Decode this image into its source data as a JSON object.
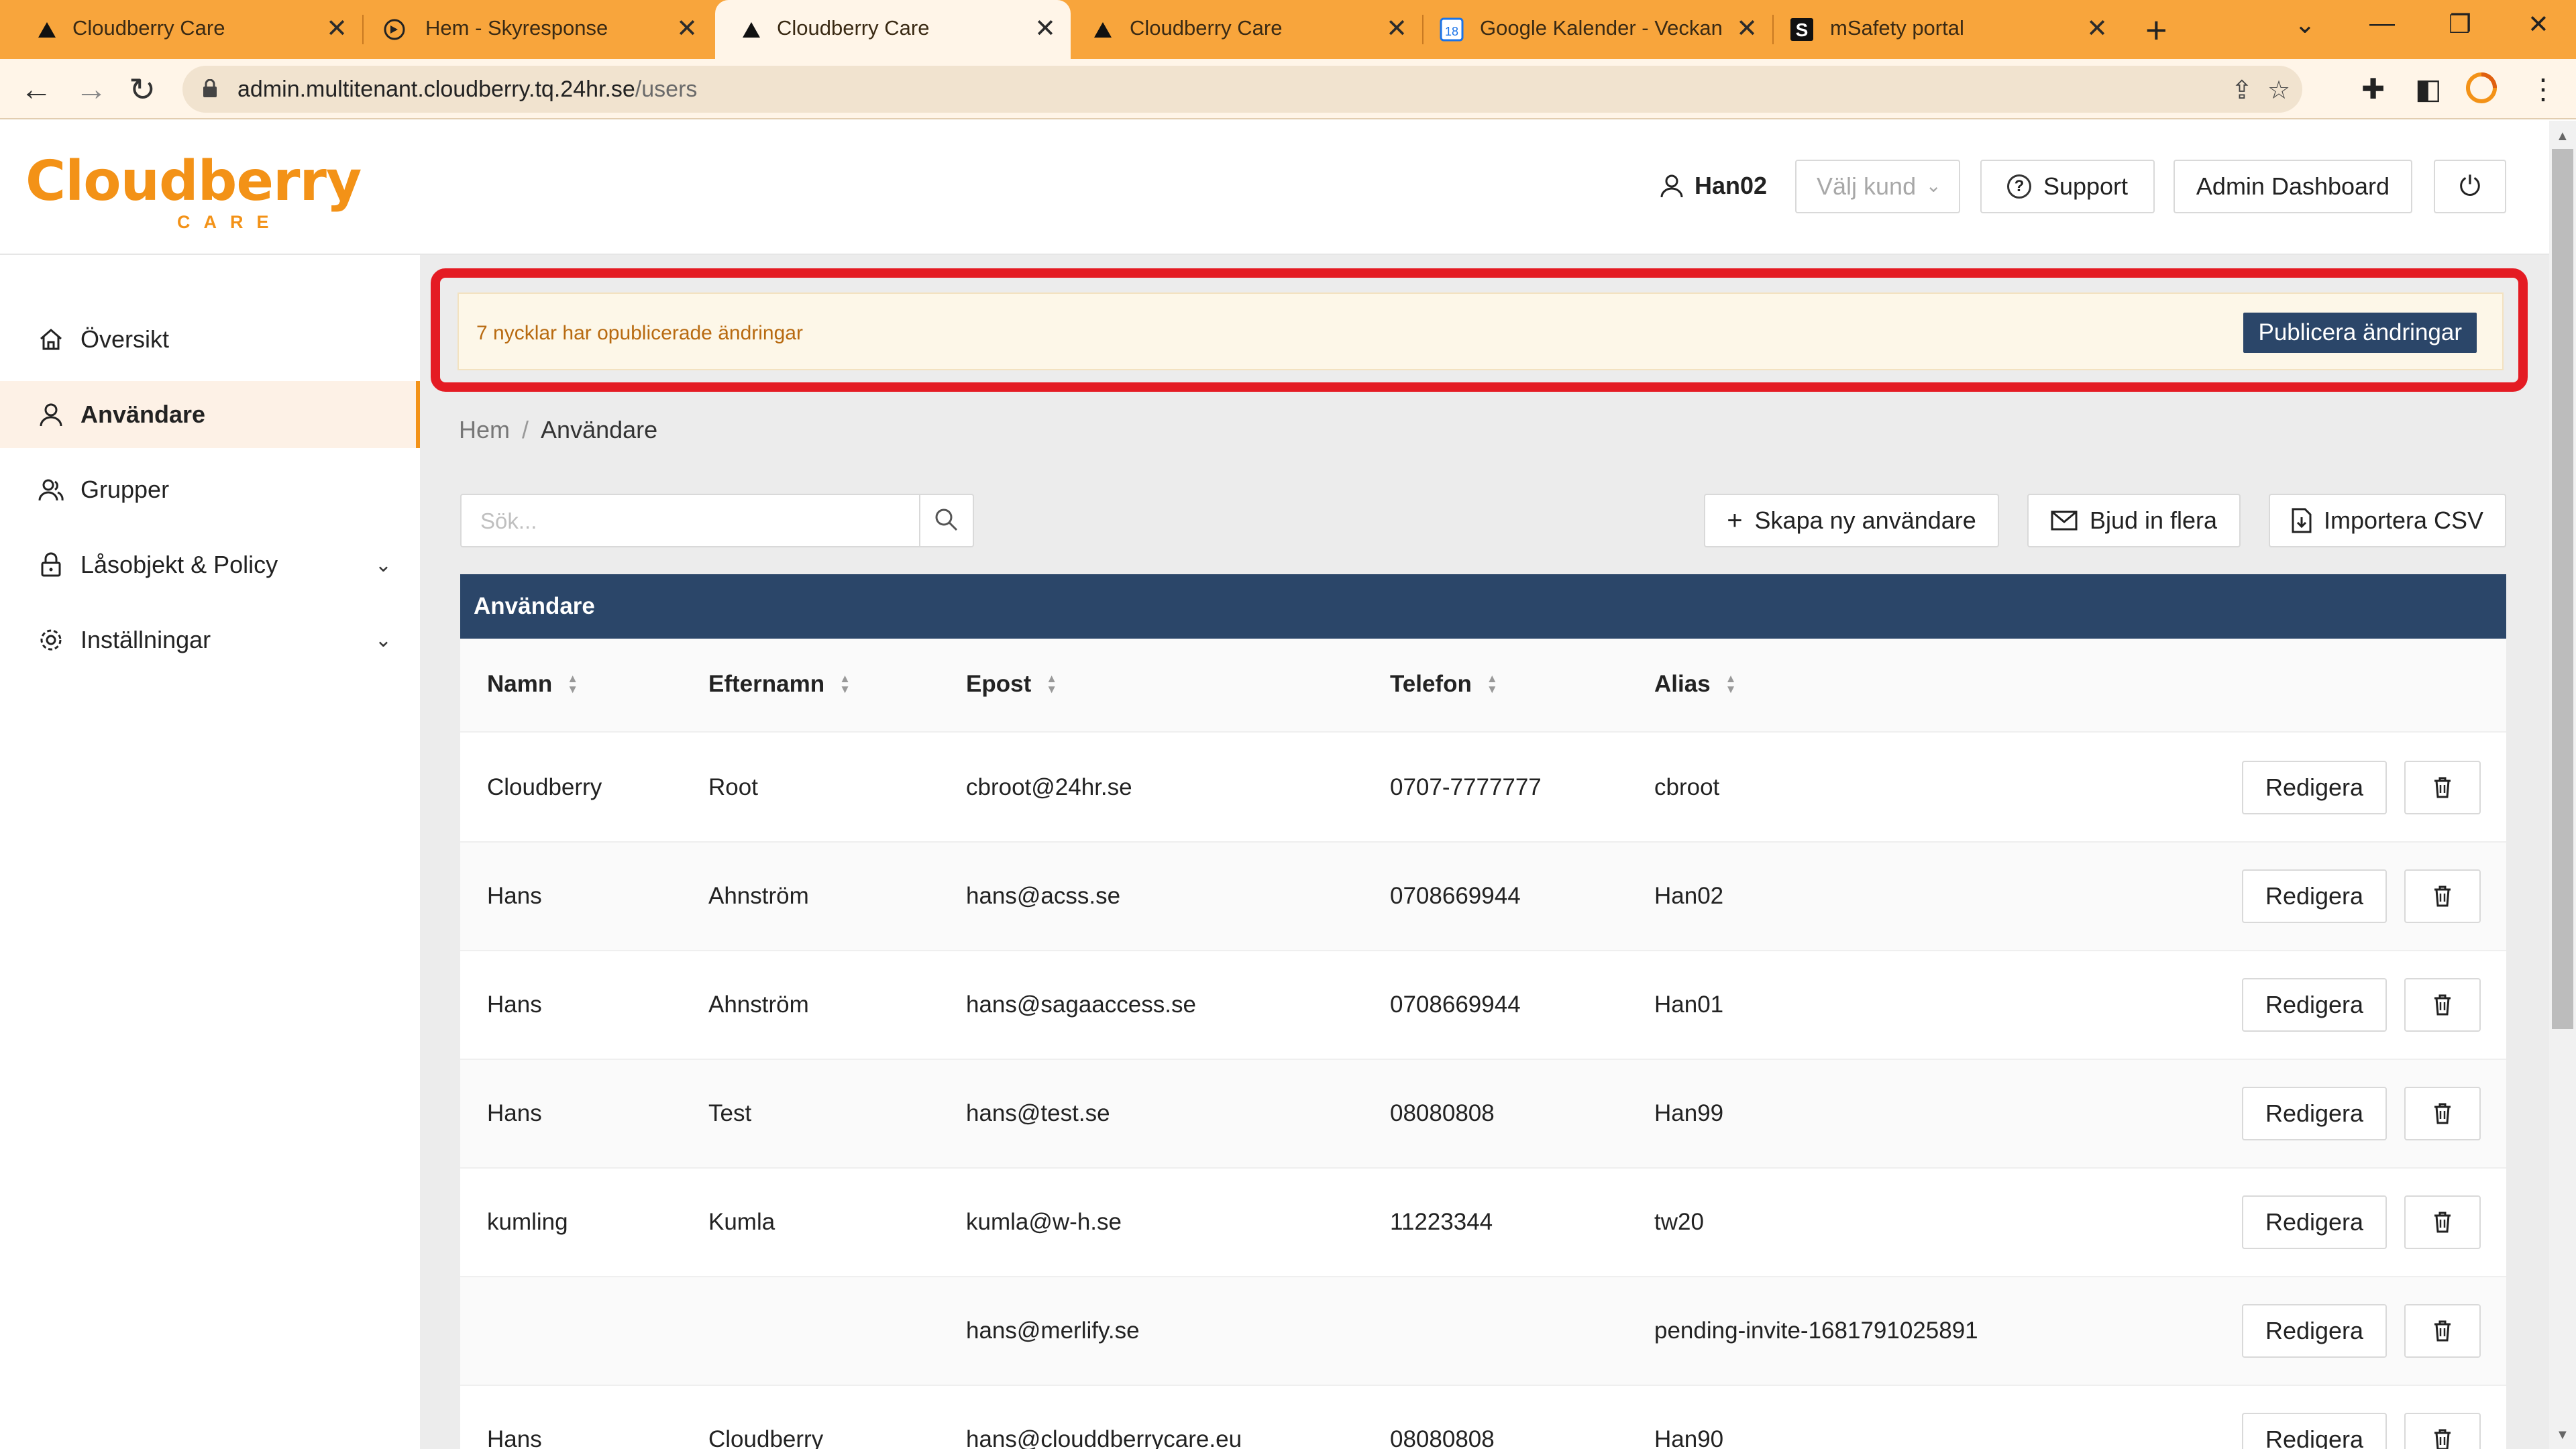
{
  "browser": {
    "tabs": [
      {
        "title": "Cloudberry Care",
        "icon": "triangle-logo-icon",
        "active": false
      },
      {
        "title": "Hem - Skyresponse",
        "icon": "skyresponse-icon",
        "active": false
      },
      {
        "title": "Cloudberry Care",
        "icon": "triangle-logo-icon",
        "active": true
      },
      {
        "title": "Cloudberry Care",
        "icon": "triangle-logo-icon",
        "active": false
      },
      {
        "title": "Google Kalender - Veckan",
        "icon": "calendar-icon",
        "active": false
      },
      {
        "title": "mSafety portal",
        "icon": "msafety-icon",
        "active": false
      }
    ],
    "calendar_day": "18",
    "msafety_letter": "S",
    "url_host": "admin.multitenant.cloudberry.tq.24hr.se",
    "url_path": "/users"
  },
  "header": {
    "logo_word": "Cloudberry",
    "logo_sub": "CARE",
    "username": "Han02",
    "customer_select_placeholder": "Välj kund",
    "support_label": "Support",
    "admin_dashboard_label": "Admin Dashboard"
  },
  "sidebar": {
    "items": [
      {
        "label": "Översikt",
        "icon": "home-icon"
      },
      {
        "label": "Användare",
        "icon": "user-icon",
        "active": true
      },
      {
        "label": "Grupper",
        "icon": "group-icon"
      },
      {
        "label": "Låsobjekt & Policy",
        "icon": "lock-icon",
        "expandable": true
      },
      {
        "label": "Inställningar",
        "icon": "settings-icon",
        "expandable": true
      }
    ]
  },
  "alert": {
    "message": "7 nycklar har opublicerade ändringar",
    "publish_label": "Publicera ändringar"
  },
  "breadcrumb": {
    "home": "Hem",
    "separator": "/",
    "current": "Användare"
  },
  "toolbar": {
    "search_placeholder": "Sök...",
    "create_label": "Skapa ny användare",
    "invite_label": "Bjud in flera",
    "import_label": "Importera CSV"
  },
  "table": {
    "title": "Användare",
    "columns": [
      "Namn",
      "Efternamn",
      "Epost",
      "Telefon",
      "Alias"
    ],
    "edit_label": "Redigera",
    "rows": [
      {
        "first": "Cloudberry",
        "last": "Root",
        "email": "cbroot@24hr.se",
        "phone": "0707-7777777",
        "alias": "cbroot"
      },
      {
        "first": "Hans",
        "last": "Ahnström",
        "email": "hans@acss.se",
        "phone": "0708669944",
        "alias": "Han02"
      },
      {
        "first": "Hans",
        "last": "Ahnström",
        "email": "hans@sagaaccess.se",
        "phone": "0708669944",
        "alias": "Han01"
      },
      {
        "first": "Hans",
        "last": "Test",
        "email": "hans@test.se",
        "phone": "08080808",
        "alias": "Han99"
      },
      {
        "first": "kumling",
        "last": "Kumla",
        "email": "kumla@w-h.se",
        "phone": "11223344",
        "alias": "tw20"
      },
      {
        "first": "",
        "last": "",
        "email": "hans@merlify.se",
        "phone": "",
        "alias": "pending-invite-1681791025891"
      },
      {
        "first": "Hans",
        "last": "Cloudberry",
        "email": "hans@clouddberrycare.eu",
        "phone": "08080808",
        "alias": "Han90"
      }
    ]
  },
  "colors": {
    "brand_orange": "#f39217",
    "tab_bar": "#f8a53c",
    "navy": "#2b4669",
    "highlight_red": "#e41b23"
  }
}
